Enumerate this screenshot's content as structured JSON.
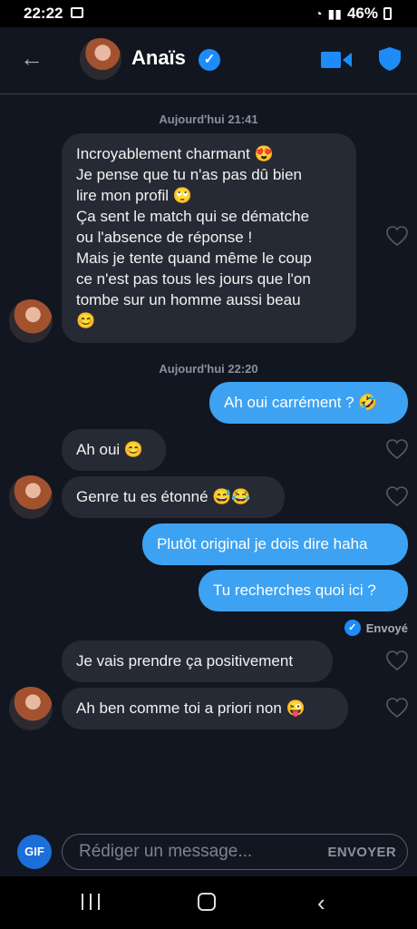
{
  "status": {
    "time": "22:22",
    "battery": "46%"
  },
  "header": {
    "contact_name": "Anaïs",
    "back_icon": "arrow-left-icon",
    "video_icon": "video-camera-icon",
    "safety_icon": "shield-icon",
    "accent": "#1d8cf8"
  },
  "timestamps": [
    "Aujourd'hui 21:41",
    "Aujourd'hui 22:20"
  ],
  "messages": [
    {
      "from": "them",
      "text": "Incroyablement charmant 😍\nJe pense que tu n'as pas dû bien\nlire mon profil 🙄\nÇa sent le match qui se dématche\nou l'absence de réponse !\nMais je tente quand même le coup\nce n'est pas tous les jours que l'on\ntombe sur un homme aussi beau\n😊"
    },
    {
      "from": "me",
      "text": "Ah oui carrément ? 🤣"
    },
    {
      "from": "them",
      "text": "Ah oui 😊"
    },
    {
      "from": "them",
      "text": "Genre tu es étonné 😅😂"
    },
    {
      "from": "me",
      "text": "Plutôt original je dois dire haha"
    },
    {
      "from": "me",
      "text": "Tu recherches quoi ici ?"
    },
    {
      "from": "them",
      "text": "Je vais prendre ça positivement"
    },
    {
      "from": "them",
      "text": "Ah ben comme toi a priori non 😜"
    }
  ],
  "delivery_status": "Envoyé",
  "composer": {
    "gif_label": "GIF",
    "placeholder": "Rédiger un message...",
    "send_label": "ENVOYER"
  },
  "colors": {
    "background": "#121620",
    "incoming_bubble": "#262a34",
    "outgoing_bubble": "#3da2f1"
  }
}
